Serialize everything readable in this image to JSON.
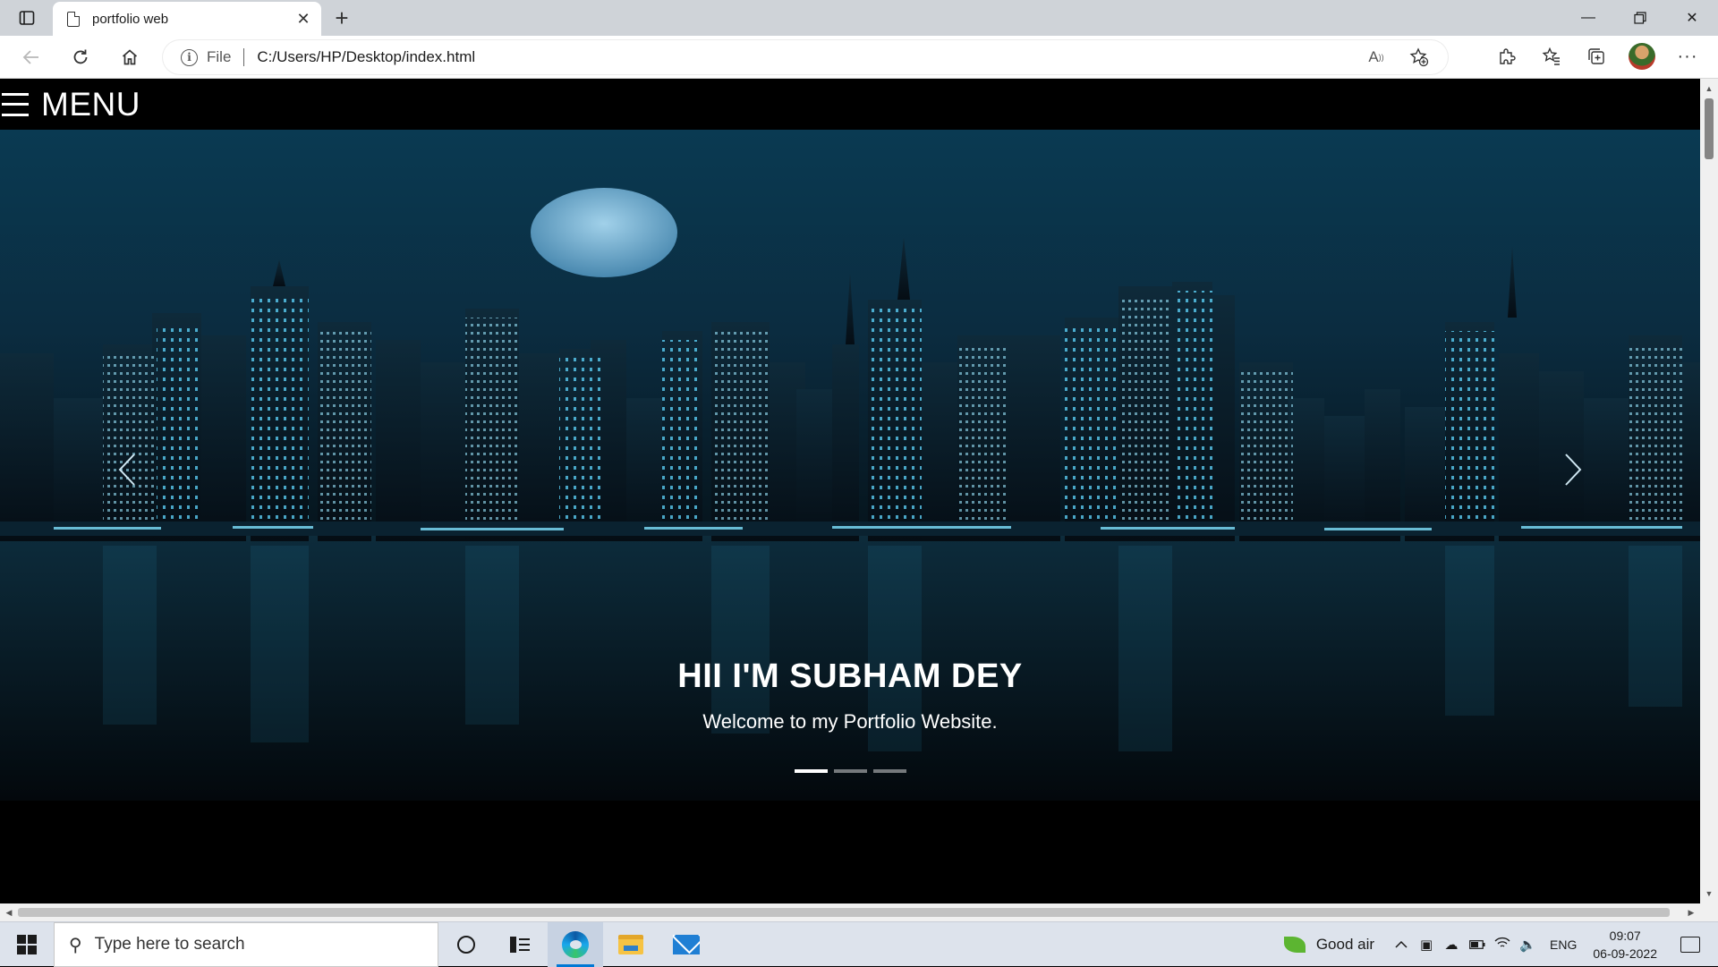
{
  "browser": {
    "tab_title": "portfolio web",
    "address_scheme": "File",
    "address_url": "C:/Users/HP/Desktop/index.html"
  },
  "page": {
    "menu_label": "MENU",
    "hero": {
      "title": "HII I'M SUBHAM DEY",
      "subtitle": "Welcome to my Portfolio Website.",
      "slides": 3,
      "active_slide": 1
    }
  },
  "taskbar": {
    "search_placeholder": "Type here to search",
    "air_quality": "Good air",
    "language": "ENG",
    "time": "09:07",
    "date": "06-09-2022"
  }
}
